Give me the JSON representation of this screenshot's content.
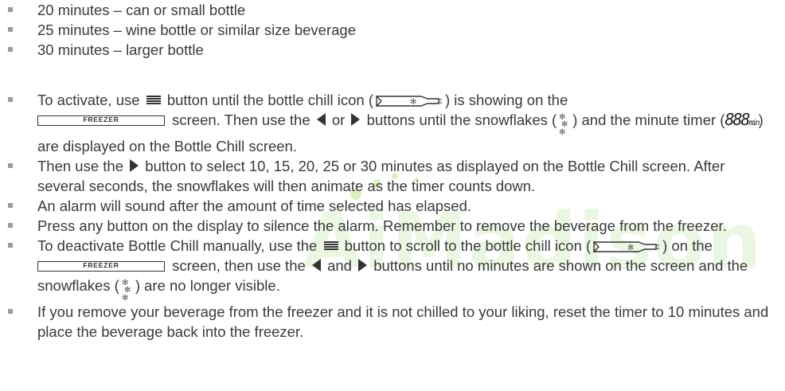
{
  "durations": [
    "20 minutes – can or small bottle",
    "25 minutes – wine bottle or similar size beverage",
    "30 minutes – larger bottle"
  ],
  "steps": {
    "activate": {
      "t1": "To activate, use",
      "t2": "button until the bottle chill icon (",
      "t3": ") is showing on the",
      "t4": "screen. Then use the",
      "t5": "or",
      "t6": "buttons until the snowflakes (",
      "t7": ") and the minute timer (",
      "timer": "888",
      "timer_sub": "min",
      "t8": ") are displayed on the Bottle Chill screen."
    },
    "select": {
      "t1": "Then use the",
      "t2": "button to select 10, 15, 20, 25 or 30 minutes as displayed on the Bottle Chill screen. After several seconds, the snowflakes will then animate as the timer counts down."
    },
    "alarm": "An alarm will sound after the amount of time selected has elapsed.",
    "silence": "Press any button on the display to silence the alarm. Remember to remove the beverage from the freezer.",
    "deactivate": {
      "t1": "To deactivate Bottle Chill manually, use the",
      "t2": "button to scroll to the bottle chill icon (",
      "t3": ") on the",
      "t4": "screen, then use the",
      "t5": "and",
      "t6": "buttons until no minutes are shown on the screen and the snowflakes (",
      "t7": ") are no longer visible."
    },
    "reset": "If you remove your beverage from the freezer and it is not chilled to your liking, reset the timer to 10 minutes and place the beverage back into the freezer."
  },
  "freezer_label": "FREEZER",
  "watermark": "AiMadison",
  "icons": {
    "menu": "menu-lines-icon",
    "left": "left-arrow-icon",
    "right": "right-arrow-icon",
    "bottle": "bottle-chill-icon",
    "snow": "snowflakes-icon"
  }
}
